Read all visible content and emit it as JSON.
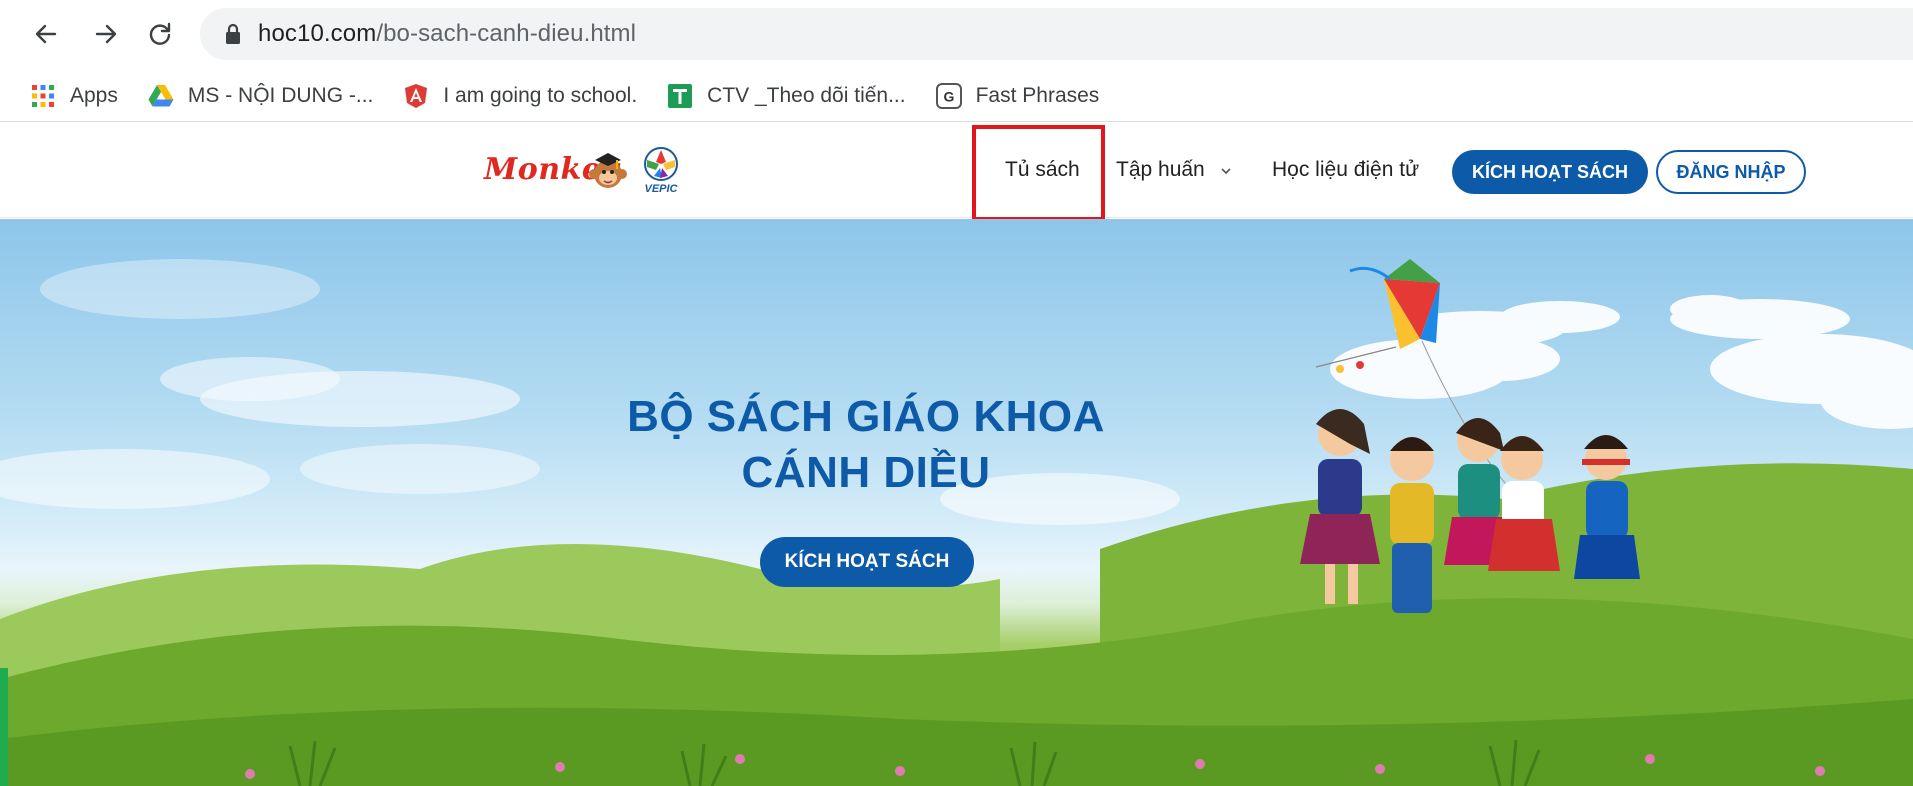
{
  "browser": {
    "url_host": "hoc10.com",
    "url_path": "/bo-sach-canh-dieu.html",
    "bookmarks": [
      {
        "label": "Apps",
        "icon": "apps-grid-icon"
      },
      {
        "label": "MS - NỘI DUNG -...",
        "icon": "google-drive-icon"
      },
      {
        "label": "I am going to school.",
        "icon": "angular-icon"
      },
      {
        "label": "CTV _Theo dõi tiến...",
        "icon": "sheets-icon"
      },
      {
        "label": "Fast Phrases",
        "icon": "fast-phrases-icon"
      }
    ]
  },
  "header": {
    "logo_text": "Monkey",
    "nav": {
      "bookshelf": "Tủ sách",
      "training": "Tập huấn",
      "e_materials": "Học liệu điện tử"
    },
    "activate_label": "KÍCH HOẠT SÁCH",
    "login_label": "ĐĂNG NHẬP"
  },
  "hero": {
    "title_line1": "BỘ SÁCH GIÁO KHOA",
    "title_line2": "CÁNH DIỀU",
    "cta_label": "KÍCH HOẠT SÁCH"
  },
  "colors": {
    "primary": "#0d5ba8",
    "highlight": "#e3161b",
    "logo_red": "#e0281f",
    "side_tab": "#1fab4e"
  }
}
